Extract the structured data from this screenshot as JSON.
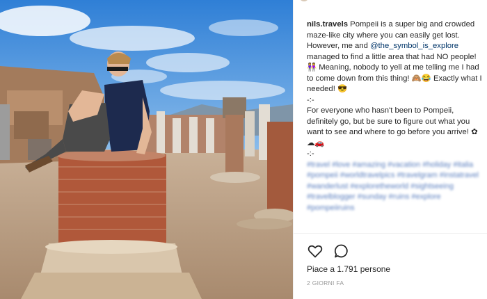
{
  "post": {
    "username": "nils.travels",
    "caption_p1_a": " Pompeii is a super big and crowded maze-like city where you can easily get lost. However, me and ",
    "mention": "@the_symbol_is_explore",
    "caption_p1_b": " managed to find a little area that had NO people! 👭 Meaning, nobody to yell at me telling me I had to come down from this thing! 🙈😂 Exactly what I needed! 😎",
    "divider1": "-:-",
    "caption_p2": "For everyone who hasn't been to Pompeii, definitely go, but be sure to figure out what you want to see and where to go before you arrive! ✿☁🚗",
    "divider2": "-:-",
    "hashtags": "#travel #love #amazing #vacation #holiday #italia #pompeii #worldtravelpics #travelgram #instatravel #wanderlust #exploretheworld #sightseeing #travelblogger #sunday #ruins #explore #pompeiiruins"
  },
  "actions": {
    "like_icon": "heart-outline-icon",
    "comment_icon": "speech-bubble-icon"
  },
  "likes_text": "Piace a 1.791 persone",
  "date_text": "2 GIORNI FA"
}
